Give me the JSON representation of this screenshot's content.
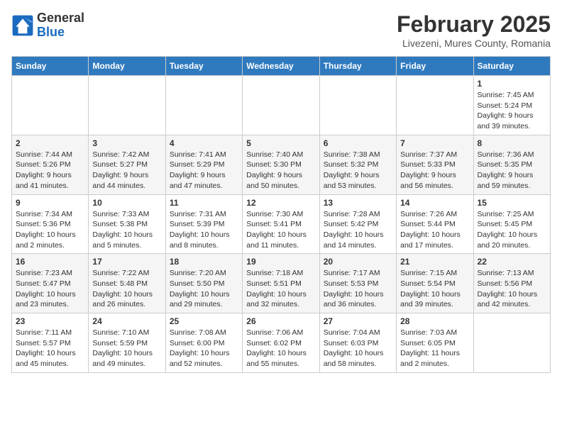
{
  "header": {
    "logo_general": "General",
    "logo_blue": "Blue",
    "title": "February 2025",
    "subtitle": "Livezeni, Mures County, Romania"
  },
  "weekdays": [
    "Sunday",
    "Monday",
    "Tuesday",
    "Wednesday",
    "Thursday",
    "Friday",
    "Saturday"
  ],
  "weeks": [
    {
      "row_class": "week-row-1",
      "days": [
        {
          "num": "",
          "info": ""
        },
        {
          "num": "",
          "info": ""
        },
        {
          "num": "",
          "info": ""
        },
        {
          "num": "",
          "info": ""
        },
        {
          "num": "",
          "info": ""
        },
        {
          "num": "",
          "info": ""
        },
        {
          "num": "1",
          "info": "Sunrise: 7:45 AM\nSunset: 5:24 PM\nDaylight: 9 hours and 39 minutes."
        }
      ]
    },
    {
      "row_class": "week-row-2",
      "days": [
        {
          "num": "2",
          "info": "Sunrise: 7:44 AM\nSunset: 5:26 PM\nDaylight: 9 hours and 41 minutes."
        },
        {
          "num": "3",
          "info": "Sunrise: 7:42 AM\nSunset: 5:27 PM\nDaylight: 9 hours and 44 minutes."
        },
        {
          "num": "4",
          "info": "Sunrise: 7:41 AM\nSunset: 5:29 PM\nDaylight: 9 hours and 47 minutes."
        },
        {
          "num": "5",
          "info": "Sunrise: 7:40 AM\nSunset: 5:30 PM\nDaylight: 9 hours and 50 minutes."
        },
        {
          "num": "6",
          "info": "Sunrise: 7:38 AM\nSunset: 5:32 PM\nDaylight: 9 hours and 53 minutes."
        },
        {
          "num": "7",
          "info": "Sunrise: 7:37 AM\nSunset: 5:33 PM\nDaylight: 9 hours and 56 minutes."
        },
        {
          "num": "8",
          "info": "Sunrise: 7:36 AM\nSunset: 5:35 PM\nDaylight: 9 hours and 59 minutes."
        }
      ]
    },
    {
      "row_class": "week-row-3",
      "days": [
        {
          "num": "9",
          "info": "Sunrise: 7:34 AM\nSunset: 5:36 PM\nDaylight: 10 hours and 2 minutes."
        },
        {
          "num": "10",
          "info": "Sunrise: 7:33 AM\nSunset: 5:38 PM\nDaylight: 10 hours and 5 minutes."
        },
        {
          "num": "11",
          "info": "Sunrise: 7:31 AM\nSunset: 5:39 PM\nDaylight: 10 hours and 8 minutes."
        },
        {
          "num": "12",
          "info": "Sunrise: 7:30 AM\nSunset: 5:41 PM\nDaylight: 10 hours and 11 minutes."
        },
        {
          "num": "13",
          "info": "Sunrise: 7:28 AM\nSunset: 5:42 PM\nDaylight: 10 hours and 14 minutes."
        },
        {
          "num": "14",
          "info": "Sunrise: 7:26 AM\nSunset: 5:44 PM\nDaylight: 10 hours and 17 minutes."
        },
        {
          "num": "15",
          "info": "Sunrise: 7:25 AM\nSunset: 5:45 PM\nDaylight: 10 hours and 20 minutes."
        }
      ]
    },
    {
      "row_class": "week-row-4",
      "days": [
        {
          "num": "16",
          "info": "Sunrise: 7:23 AM\nSunset: 5:47 PM\nDaylight: 10 hours and 23 minutes."
        },
        {
          "num": "17",
          "info": "Sunrise: 7:22 AM\nSunset: 5:48 PM\nDaylight: 10 hours and 26 minutes."
        },
        {
          "num": "18",
          "info": "Sunrise: 7:20 AM\nSunset: 5:50 PM\nDaylight: 10 hours and 29 minutes."
        },
        {
          "num": "19",
          "info": "Sunrise: 7:18 AM\nSunset: 5:51 PM\nDaylight: 10 hours and 32 minutes."
        },
        {
          "num": "20",
          "info": "Sunrise: 7:17 AM\nSunset: 5:53 PM\nDaylight: 10 hours and 36 minutes."
        },
        {
          "num": "21",
          "info": "Sunrise: 7:15 AM\nSunset: 5:54 PM\nDaylight: 10 hours and 39 minutes."
        },
        {
          "num": "22",
          "info": "Sunrise: 7:13 AM\nSunset: 5:56 PM\nDaylight: 10 hours and 42 minutes."
        }
      ]
    },
    {
      "row_class": "week-row-5",
      "days": [
        {
          "num": "23",
          "info": "Sunrise: 7:11 AM\nSunset: 5:57 PM\nDaylight: 10 hours and 45 minutes."
        },
        {
          "num": "24",
          "info": "Sunrise: 7:10 AM\nSunset: 5:59 PM\nDaylight: 10 hours and 49 minutes."
        },
        {
          "num": "25",
          "info": "Sunrise: 7:08 AM\nSunset: 6:00 PM\nDaylight: 10 hours and 52 minutes."
        },
        {
          "num": "26",
          "info": "Sunrise: 7:06 AM\nSunset: 6:02 PM\nDaylight: 10 hours and 55 minutes."
        },
        {
          "num": "27",
          "info": "Sunrise: 7:04 AM\nSunset: 6:03 PM\nDaylight: 10 hours and 58 minutes."
        },
        {
          "num": "28",
          "info": "Sunrise: 7:03 AM\nSunset: 6:05 PM\nDaylight: 11 hours and 2 minutes."
        },
        {
          "num": "",
          "info": ""
        }
      ]
    }
  ]
}
